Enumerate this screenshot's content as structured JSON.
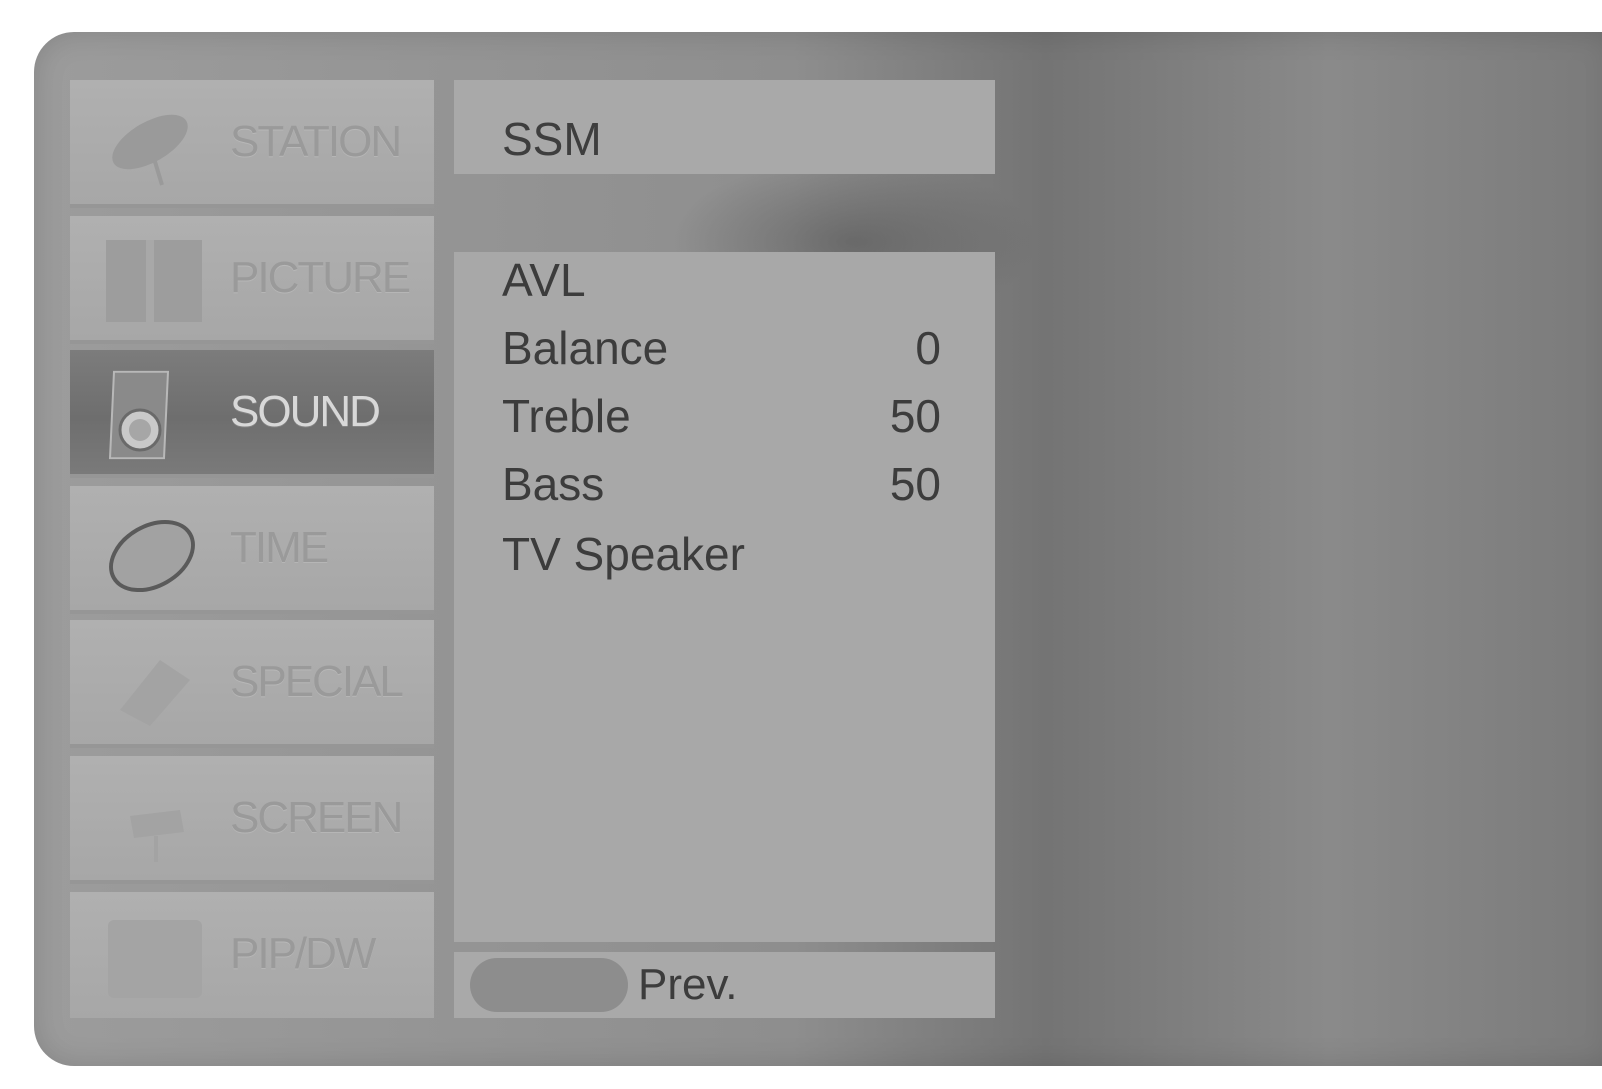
{
  "menu": {
    "items": [
      {
        "label": "STATION",
        "icon": "satellite-dish-icon",
        "active": false
      },
      {
        "label": "PICTURE",
        "icon": "picture-icon",
        "active": false
      },
      {
        "label": "SOUND",
        "icon": "speaker-icon",
        "active": true
      },
      {
        "label": "TIME",
        "icon": "clock-icon",
        "active": false
      },
      {
        "label": "SPECIAL",
        "icon": "special-icon",
        "active": false
      },
      {
        "label": "SCREEN",
        "icon": "screen-icon",
        "active": false
      },
      {
        "label": "PIP/DW",
        "icon": "pip-icon",
        "active": false
      }
    ]
  },
  "panel": {
    "title": "SSM",
    "rows": [
      {
        "label": "AVL",
        "value": ""
      },
      {
        "label": "Balance",
        "value": "0"
      },
      {
        "label": "Treble",
        "value": "50"
      },
      {
        "label": "Bass",
        "value": "50"
      },
      {
        "label": "TV Speaker",
        "value": ""
      }
    ],
    "footer": "Prev."
  }
}
